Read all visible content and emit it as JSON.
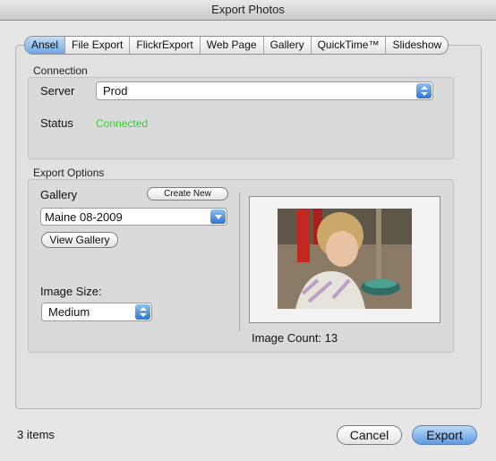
{
  "window": {
    "title": "Export Photos"
  },
  "tabs": [
    {
      "label": "Ansel",
      "active": true
    },
    {
      "label": "File Export",
      "active": false
    },
    {
      "label": "FlickrExport",
      "active": false
    },
    {
      "label": "Web Page",
      "active": false
    },
    {
      "label": "Gallery",
      "active": false
    },
    {
      "label": "QuickTime™",
      "active": false
    },
    {
      "label": "Slideshow",
      "active": false
    }
  ],
  "connection": {
    "group_label": "Connection",
    "server_label": "Server",
    "server_value": "Prod",
    "status_label": "Status",
    "status_value": "Connected",
    "status_color": "#32d12f"
  },
  "export_options": {
    "group_label": "Export Options",
    "gallery_label": "Gallery",
    "create_new_label": "Create New",
    "gallery_value": "Maine 08-2009",
    "view_gallery_label": "View Gallery",
    "image_size_label": "Image Size:",
    "image_size_value": "Medium",
    "image_count_label": "Image Count: 13"
  },
  "footer": {
    "items_count": "3 items",
    "cancel_label": "Cancel",
    "export_label": "Export"
  },
  "colors": {
    "accent": "#5f9be3"
  }
}
